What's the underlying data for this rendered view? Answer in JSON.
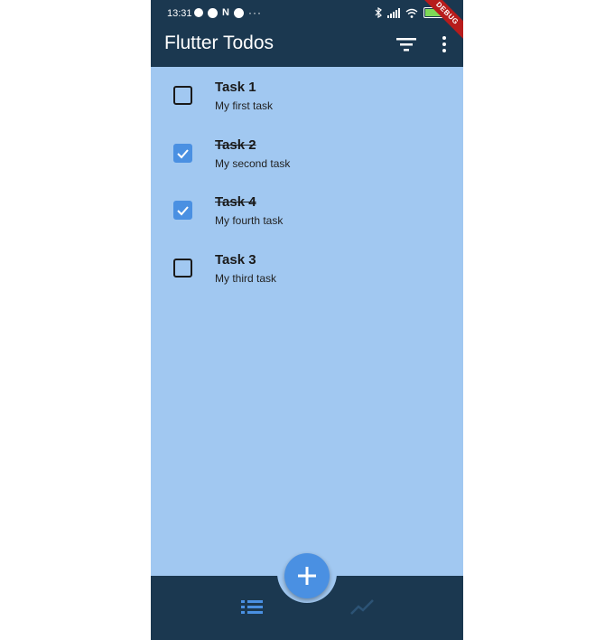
{
  "status_bar": {
    "time": "13:31",
    "n_label": "N",
    "dots": "···",
    "debug": "DEBUG"
  },
  "app_bar": {
    "title": "Flutter Todos"
  },
  "todos": [
    {
      "title": "Task 1",
      "subtitle": "My first task",
      "completed": false
    },
    {
      "title": "Task 2",
      "subtitle": "My second task",
      "completed": true
    },
    {
      "title": "Task 4",
      "subtitle": "My fourth task",
      "completed": true
    },
    {
      "title": "Task 3",
      "subtitle": "My third task",
      "completed": false
    }
  ],
  "bottom_nav": {
    "selected_tab": "list",
    "tabs": [
      "list",
      "stats"
    ]
  },
  "colors": {
    "app_bar": "#1b3850",
    "background": "#a1c8f1",
    "accent": "#4a90e2",
    "inactive_tab": "#2c5375"
  },
  "icons": {
    "filter": "filter-list-icon",
    "more": "more-vert-icon",
    "fab": "plus-icon",
    "list_tab": "list-icon",
    "stats_tab": "show-chart-icon"
  }
}
